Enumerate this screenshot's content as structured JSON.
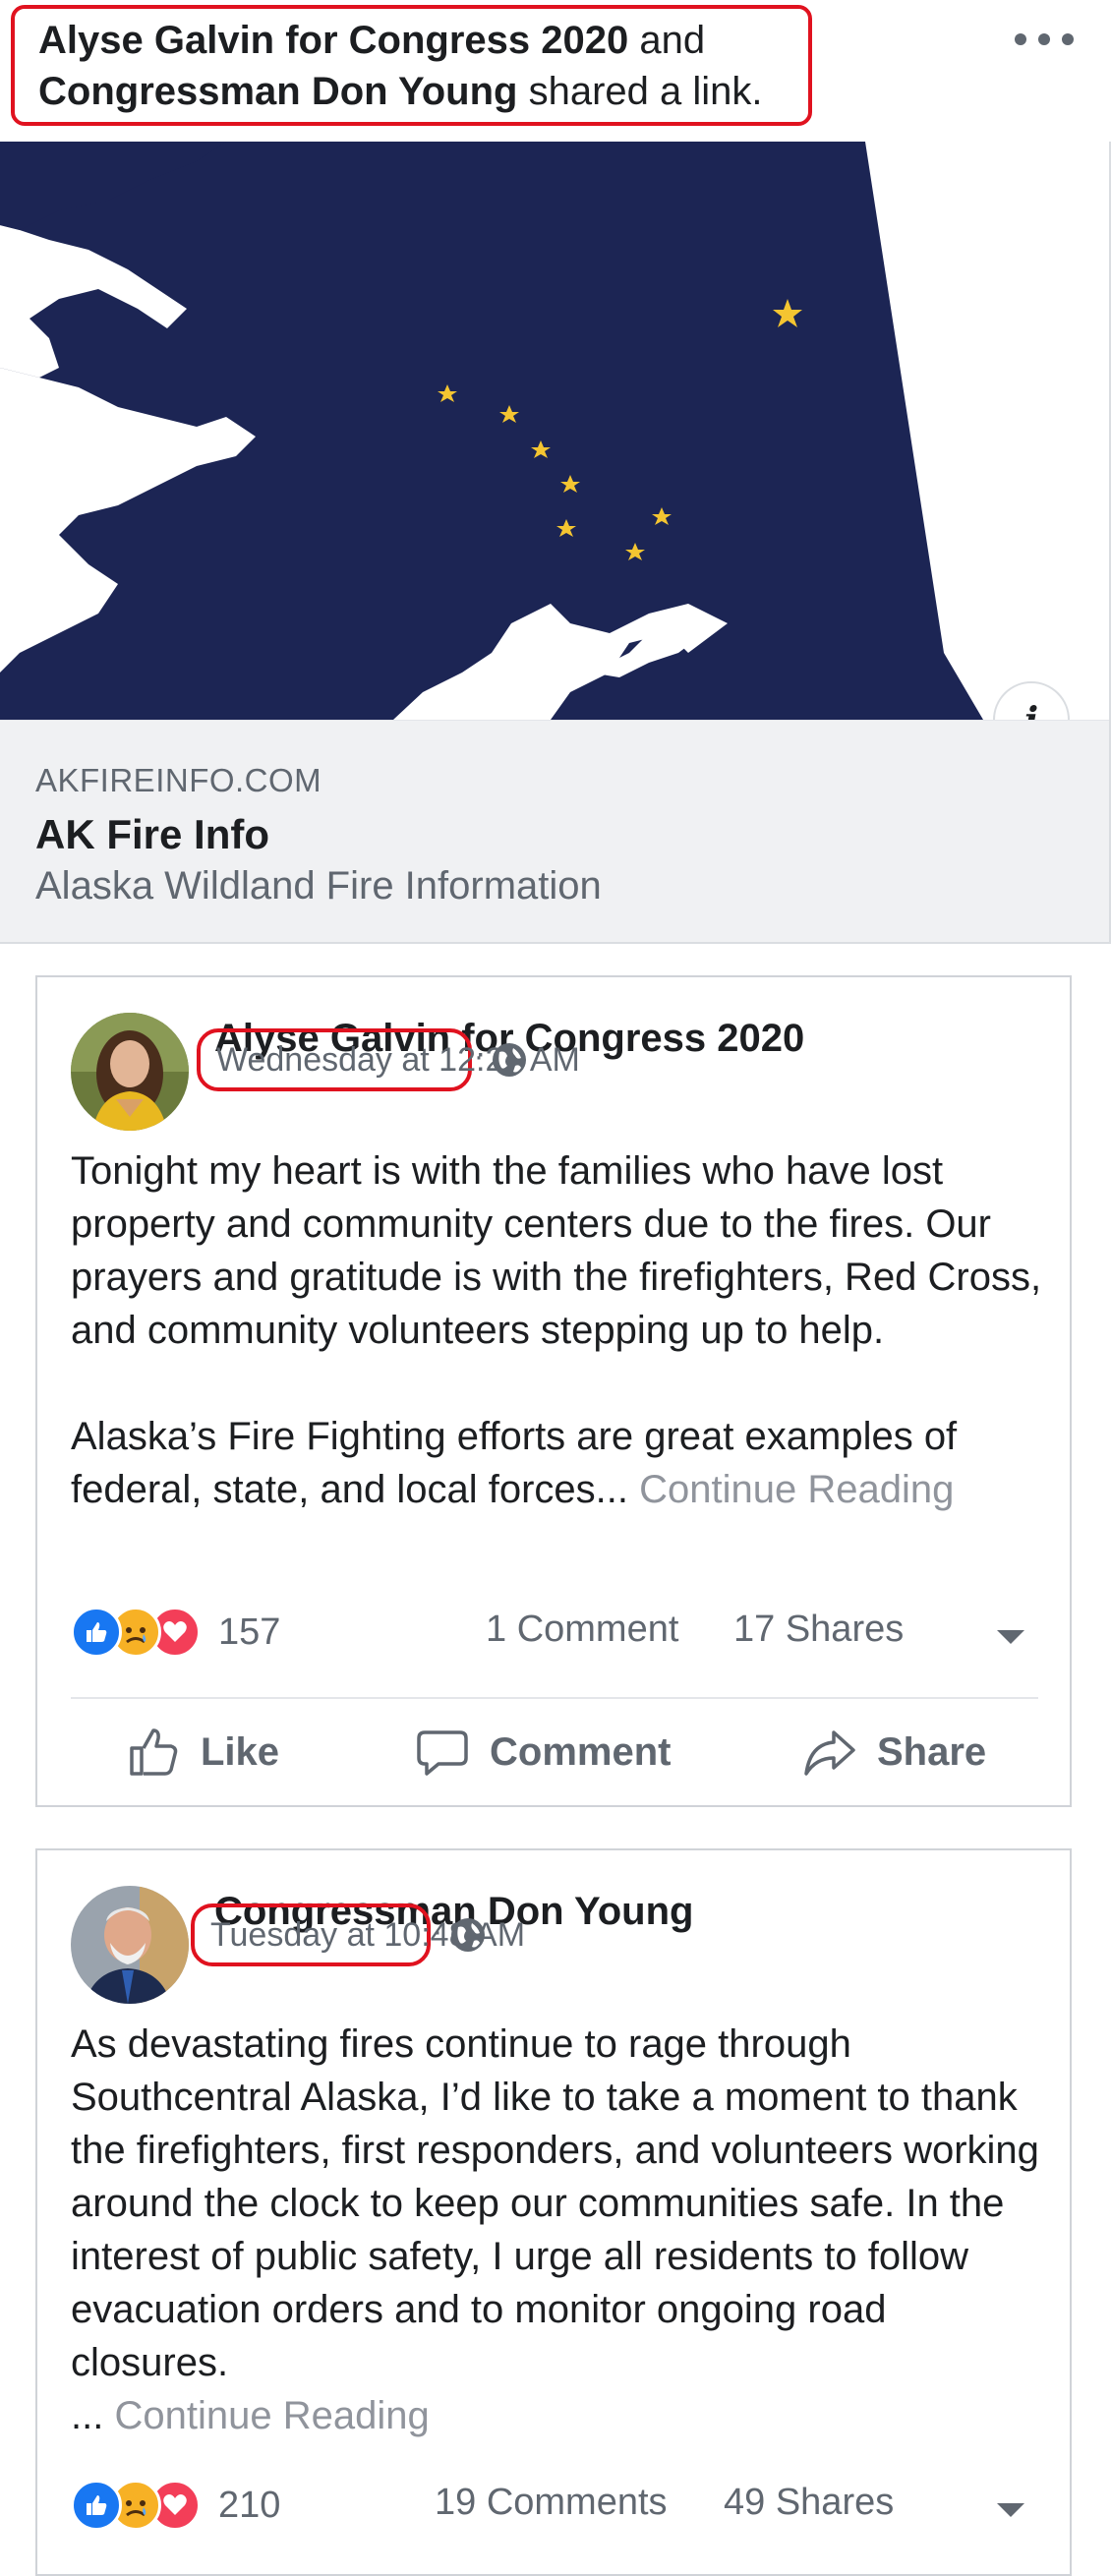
{
  "header": {
    "author1": "Alyse Galvin for Congress 2020",
    "connector": "and",
    "author2": "Congressman Don Young",
    "action": "shared a link.",
    "highlight_color": "#e0121f"
  },
  "link_card": {
    "domain": "AKFIREINFO.COM",
    "title": "AK Fire Info",
    "description": "Alaska Wildland Fire Information",
    "map_colors": {
      "land": "#1c2554",
      "star": "#f4c531"
    }
  },
  "posts": [
    {
      "author": "Alyse Galvin for Congress 2020",
      "timestamp": "Wednesday at 12:23 AM",
      "body": "Tonight my heart is with the families who have lost property and community centers due to the fires. Our prayers and gratitude is with the firefighters, Red Cross, and community volunteers stepping up to help.\n\nAlaska’s Fire Fighting efforts are great examples of federal, state, and local forces...",
      "continue": "Continue Reading",
      "reaction_count": "157",
      "comments": "1 Comment",
      "shares": "17 Shares",
      "actions": {
        "like": "Like",
        "comment": "Comment",
        "share": "Share"
      }
    },
    {
      "author": "Congressman Don Young",
      "timestamp": "Tuesday at 10:48 AM",
      "body": "As devastating fires continue to rage through Southcentral Alaska, I’d like to take a moment to thank the firefighters, first responders, and volunteers working around the clock to keep our communities safe. In the interest of public safety, I urge all residents to follow evacuation orders and to monitor ongoing road closures.",
      "ellipsis": "...",
      "continue": "Continue Reading",
      "reaction_count": "210",
      "comments": "19 Comments",
      "shares": "49 Shares"
    }
  ],
  "reaction_icons": [
    "like-icon",
    "sad-icon",
    "love-icon"
  ],
  "colors": {
    "like_blue": "#1877f2",
    "love_red": "#f33e58",
    "sad_yellow": "#f7b125",
    "meta_gray": "#606770"
  }
}
